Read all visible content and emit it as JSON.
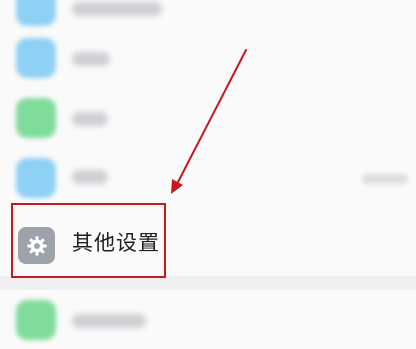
{
  "settings_list": {
    "highlighted_item": {
      "label": "其他设置",
      "icon": "gear-icon"
    },
    "blurred_items": [
      {
        "icon_color": "#8fd0f5"
      },
      {
        "icon_color": "#8fd0f5"
      },
      {
        "icon_color": "#7fdc9b"
      },
      {
        "icon_color": "#8fd0f5"
      },
      {
        "icon_color": "#7fdc9b"
      }
    ]
  },
  "annotation": {
    "box_color": "#c4191f",
    "arrow_color": "#c4191f"
  }
}
